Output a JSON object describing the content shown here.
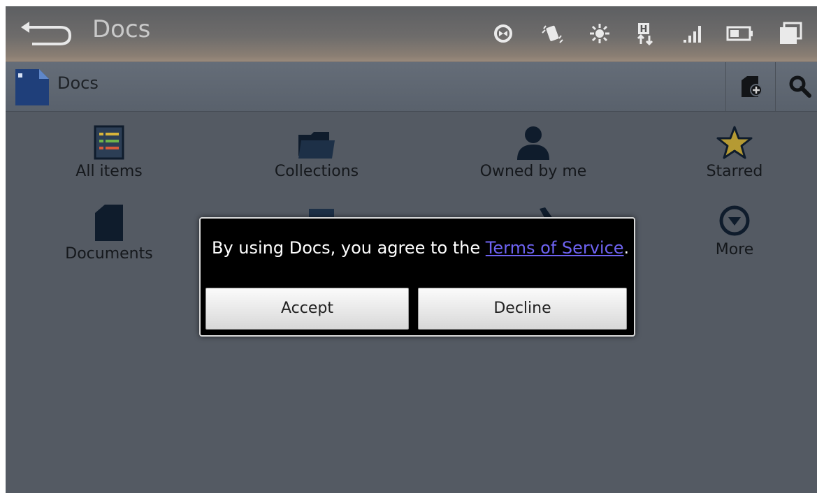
{
  "statusbar": {
    "title": "Docs",
    "icons": [
      "back-arrow-icon",
      "sync-icon",
      "vibrate-icon",
      "brightness-icon",
      "hsdpa-data-icon",
      "signal-icon",
      "battery-icon",
      "recent-apps-icon"
    ]
  },
  "actionbar": {
    "title": "Docs",
    "actions": [
      "new-document-icon",
      "search-icon"
    ]
  },
  "categories": [
    {
      "label": "All items",
      "icon": "list-icon"
    },
    {
      "label": "Collections",
      "icon": "folder-icon"
    },
    {
      "label": "Owned by me",
      "icon": "person-icon"
    },
    {
      "label": "Starred",
      "icon": "star-icon"
    },
    {
      "label": "Documents",
      "icon": "document-icon"
    },
    {
      "label": "More",
      "icon": "chevron-down-circle-icon"
    }
  ],
  "dialog": {
    "message_prefix": "By using Docs, you agree to the ",
    "link_text": "Terms of Service",
    "message_suffix": ".",
    "accept_label": "Accept",
    "decline_label": "Decline"
  },
  "colors": {
    "background": "#545a63",
    "link": "#6e63f2",
    "star": "#b59a33",
    "icon_dark": "#0f1c2c"
  }
}
